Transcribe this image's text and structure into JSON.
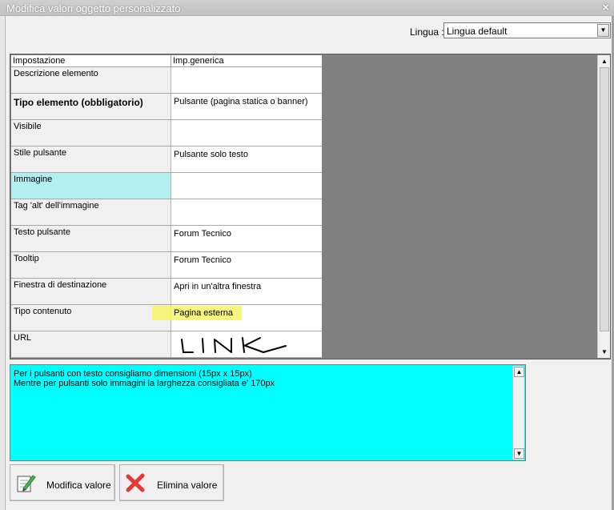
{
  "window": {
    "title": "Modifica valori oggetto personalizzato",
    "close": "×"
  },
  "language": {
    "label": "Lingua :",
    "value": "Lingua default"
  },
  "grid": {
    "headers": [
      "Impostazione",
      "Imp.generica"
    ],
    "rows": [
      {
        "setting": "Descrizione elemento",
        "value": ""
      },
      {
        "setting": "Tipo elemento (obbligatorio)",
        "value": "Pulsante (pagina statica o banner)"
      },
      {
        "setting": "Visibile",
        "value": ""
      },
      {
        "setting": "Stile pulsante",
        "value": "Pulsante solo testo"
      },
      {
        "setting": "Immagine",
        "value": ""
      },
      {
        "setting": "Tag 'alt' dell'immagine",
        "value": ""
      },
      {
        "setting": "Testo pulsante",
        "value": "Forum Tecnico"
      },
      {
        "setting": "Tooltip",
        "value": "Forum Tecnico"
      },
      {
        "setting": "Finestra di destinazione",
        "value": "Apri in un'altra finestra"
      },
      {
        "setting": "Tipo contenuto",
        "value": "Pagina esterna"
      },
      {
        "setting": "URL",
        "value": "LINK"
      }
    ]
  },
  "hint": {
    "line1": "Per i pulsanti con testo consigliamo dimensioni (15px x 15px)",
    "line2": "Mentre per pulsanti solo immagini la larghezza consigliata e' 170px"
  },
  "buttons": {
    "edit": "Modifica valore",
    "delete": "Elimina valore"
  },
  "colors": {
    "hint_bg": "#00ffff",
    "selected_row": "#b3eef0",
    "highlight": "#f6f66a",
    "grid_bg": "#808080"
  },
  "icons": {
    "edit": "pencil-notepad-icon",
    "delete": "red-x-icon"
  }
}
